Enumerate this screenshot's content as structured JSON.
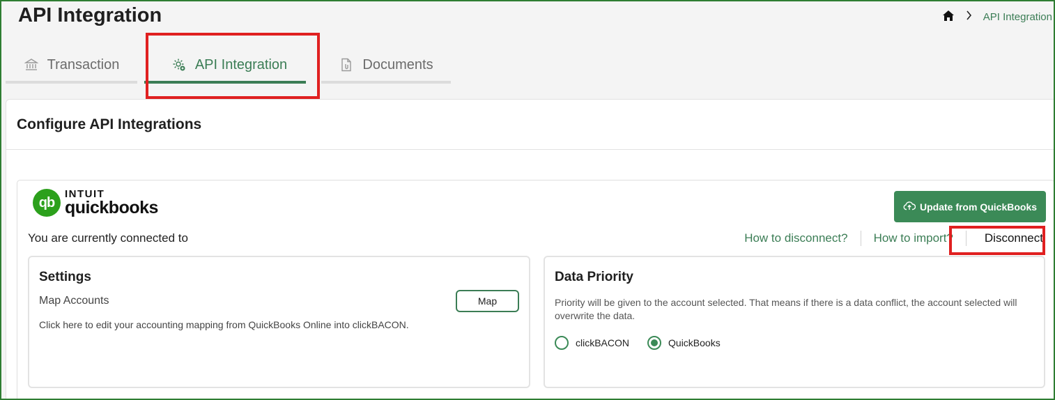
{
  "header": {
    "title": "API Integration",
    "breadcrumb": {
      "home_icon": "home-icon",
      "separator_icon": "chevron-right-icon",
      "current": "API Integration"
    }
  },
  "tabs": [
    {
      "label": "Transaction",
      "icon": "bank-icon",
      "active": false
    },
    {
      "label": "API Integration",
      "icon": "gear-settings-icon",
      "active": true
    },
    {
      "label": "Documents",
      "icon": "document-icon",
      "active": false
    }
  ],
  "main": {
    "title": "Configure API Integrations",
    "integration": {
      "logo": {
        "brand_top": "INTUIT",
        "brand_name": "quickbooks",
        "mark": "qb"
      },
      "update_button": "Update from QuickBooks",
      "connected_text": "You are currently connected to",
      "links": {
        "how_disconnect": "How to disconnect?",
        "how_import": "How to import?",
        "disconnect": "Disconnect"
      },
      "settings": {
        "title": "Settings",
        "map_accounts_label": "Map Accounts",
        "map_button": "Map",
        "description": "Click here to edit your accounting mapping from QuickBooks Online into clickBACON."
      },
      "data_priority": {
        "title": "Data Priority",
        "description": "Priority will be given to the account selected. That means if there is a data conflict, the account selected will overwrite the data.",
        "options": [
          {
            "label": "clickBACON",
            "selected": false
          },
          {
            "label": "QuickBooks",
            "selected": true
          }
        ]
      }
    }
  },
  "colors": {
    "accent": "#3b7d55",
    "button_green": "#3b8a57",
    "highlight_red": "#e02020",
    "qb_green": "#2ca01c"
  }
}
